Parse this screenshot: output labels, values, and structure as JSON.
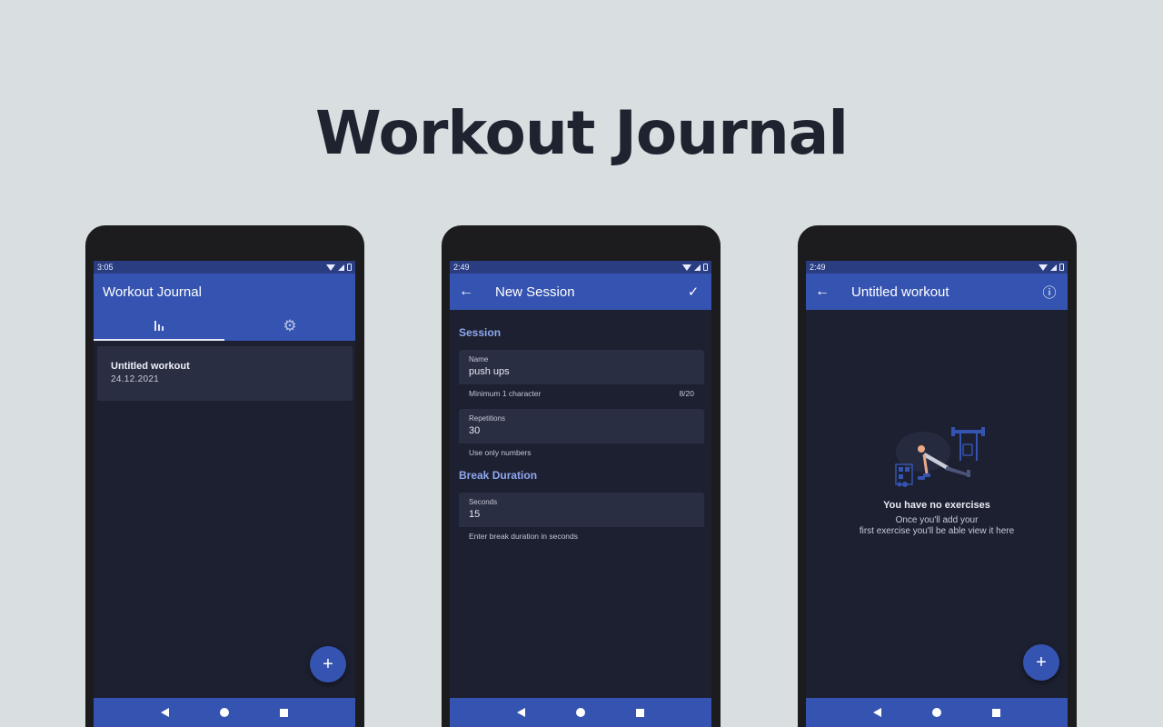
{
  "headline": "Workout Journal",
  "colors": {
    "primary": "#3553b0",
    "status_bar": "#2a3d80",
    "background": "#1d2030",
    "surface": "#2a2e42",
    "accent": "#8fa8f0"
  },
  "phone1": {
    "time": "3:05",
    "app_title": "Workout Journal",
    "tabs": [
      {
        "icon": "bar-chart-icon",
        "active": true
      },
      {
        "icon": "gear-icon",
        "active": false
      }
    ],
    "workouts": [
      {
        "title": "Untitled workout",
        "date": "24.12.2021"
      }
    ],
    "fab": "+"
  },
  "phone2": {
    "time": "2:49",
    "title": "New Session",
    "back_glyph": "←",
    "confirm_glyph": "✓",
    "session_header": "Session",
    "name_label": "Name",
    "name_value": "push ups",
    "name_helper": "Minimum 1 character",
    "name_counter": "8/20",
    "reps_label": "Repetitions",
    "reps_value": "30",
    "reps_helper": "Use only numbers",
    "break_header": "Break Duration",
    "seconds_label": "Seconds",
    "seconds_value": "15",
    "seconds_helper": "Enter break duration in seconds"
  },
  "phone3": {
    "time": "2:49",
    "title": "Untitled workout",
    "back_glyph": "←",
    "info_glyph": "ⓘ",
    "empty_title": "You have no exercises",
    "empty_line1": "Once you'll add your",
    "empty_line2": "first exercise you'll be able view it here",
    "fab": "+"
  }
}
